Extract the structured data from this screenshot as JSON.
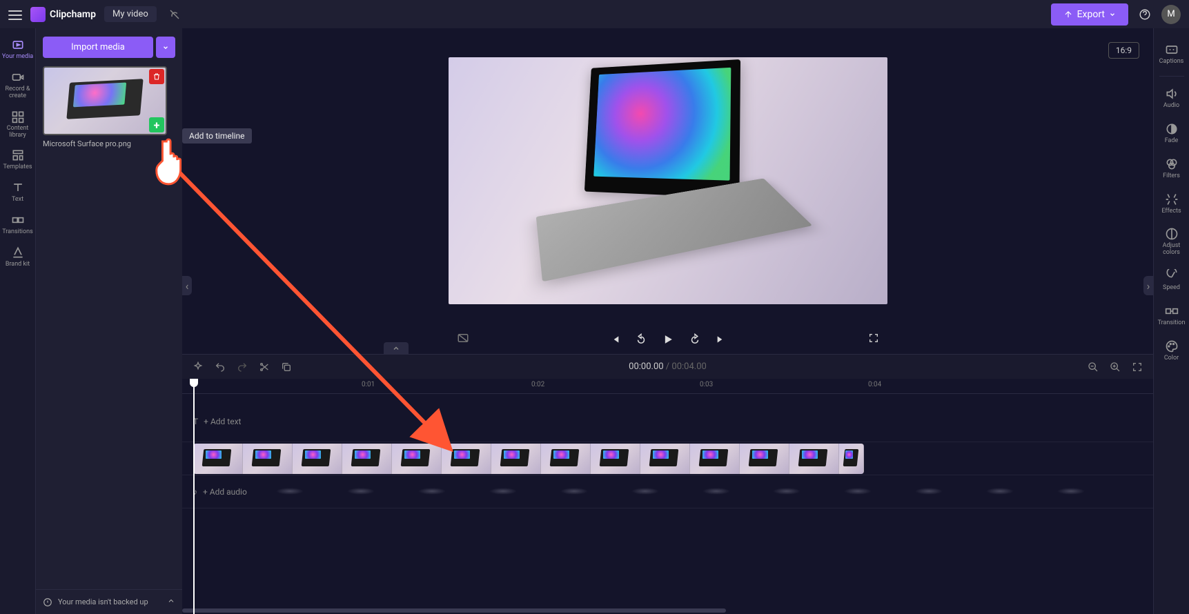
{
  "header": {
    "brand": "Clipchamp",
    "title": "My video",
    "export": "Export",
    "avatar_initial": "M"
  },
  "nav": {
    "your_media": "Your media",
    "record_create": "Record & create",
    "content_library": "Content library",
    "templates": "Templates",
    "text": "Text",
    "transitions": "Transitions",
    "brand_kit": "Brand kit"
  },
  "media": {
    "import": "Import media",
    "item_name": "Microsoft Surface pro.png",
    "tooltip": "Add to timeline"
  },
  "preview": {
    "aspect": "16:9"
  },
  "timeline": {
    "current": "00:00.00",
    "sep": " / ",
    "total": "00:04.00",
    "marks": [
      "0:01",
      "0:02",
      "0:03",
      "0:04"
    ],
    "add_text": "+  Add text",
    "add_audio": "+  Add audio"
  },
  "right": {
    "captions": "Captions",
    "audio": "Audio",
    "fade": "Fade",
    "filters": "Filters",
    "effects": "Effects",
    "adjust_colors": "Adjust colors",
    "speed": "Speed",
    "transition": "Transition",
    "color": "Color"
  },
  "footer": {
    "backup": "Your media isn't backed up"
  }
}
